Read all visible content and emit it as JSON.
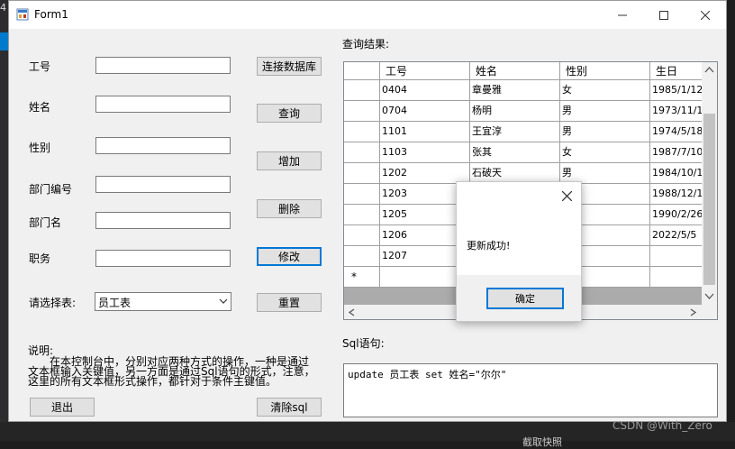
{
  "ide": {
    "line_number": "4",
    "bottom_text": "截取快照"
  },
  "window": {
    "title": "Form1",
    "minimize_icon": "minimize-icon",
    "maximize_icon": "maximize-icon",
    "close_icon": "close-icon"
  },
  "form": {
    "fields": {
      "emp_id": {
        "label": "工号",
        "value": ""
      },
      "name": {
        "label": "姓名",
        "value": ""
      },
      "gender": {
        "label": "性别",
        "value": ""
      },
      "dept_no": {
        "label": "部门编号",
        "value": ""
      },
      "dept_name": {
        "label": "部门名",
        "value": ""
      },
      "position": {
        "label": "职务",
        "value": ""
      }
    },
    "table_select": {
      "label": "请选择表:",
      "value": "员工表"
    },
    "buttons": {
      "connect": "连接数据库",
      "query": "查询",
      "add": "增加",
      "delete": "删除",
      "update": "修改",
      "reset": "重置",
      "exit": "退出",
      "clear_sql": "清除sql"
    },
    "description": {
      "title": "说明:",
      "line1": "在本控制台中，分别对应两种方式的操作，一种是通过",
      "line2": "文本框输入关键值，另一方面是通过Sql语句的形式，注意，",
      "line3": "这里的所有文本框形式操作，都针对于条件主键值。"
    }
  },
  "results": {
    "label": "查询结果:",
    "columns": [
      "工号",
      "姓名",
      "性别",
      "生日"
    ],
    "rows": [
      [
        "0404",
        "章曼雅",
        "女",
        "1985/1/12"
      ],
      [
        "0704",
        "杨明",
        "男",
        "1973/11/1"
      ],
      [
        "1101",
        "王宜淳",
        "男",
        "1974/5/18"
      ],
      [
        "1103",
        "张其",
        "女",
        "1987/7/10"
      ],
      [
        "1202",
        "石破天",
        "男",
        "1984/10/1"
      ],
      [
        "1203",
        "",
        "",
        "1988/12/1"
      ],
      [
        "1205",
        "",
        "",
        "1990/2/26"
      ],
      [
        "1206",
        "",
        "",
        "2022/5/5"
      ],
      [
        "1207",
        "",
        "",
        ""
      ]
    ],
    "new_row_marker": "*"
  },
  "sql": {
    "label": "Sql语句:",
    "value": "update 员工表 set 姓名=\"尔尔\""
  },
  "dialog": {
    "message": "更新成功!",
    "ok": "确定",
    "close_icon": "close-icon"
  },
  "watermark": "CSDN @With_Zero"
}
